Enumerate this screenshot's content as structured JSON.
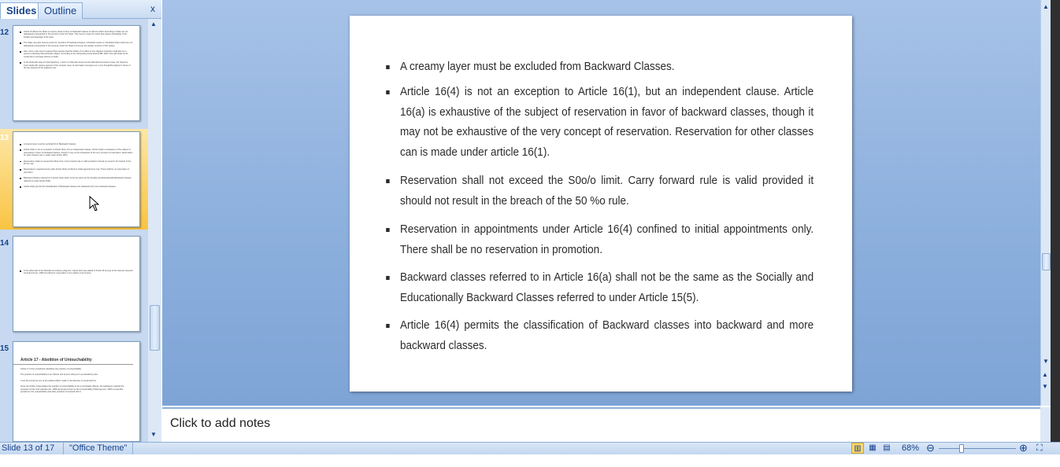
{
  "left_pane": {
    "tabs": [
      "Slides",
      "Outline"
    ],
    "close_glyph": "x",
    "slides": [
      {
        "number": "12",
        "bullets": [
          "Article 16 allows the State to reserve seats in favor of backward classes of citizens which according to State are not adequately represented in the services under the State. This may be meant for posts that require knowledge of the locality and language of the area.",
          "The State may also reserve posts for members of backward classes, scheduled castes or scheduled tribes which are not adequately represented in the services under the State to bring up the weaker sections of the society.",
          "Also, there a law may be passed that requires that the holder of an office of any religious institution shall also be a person professing that particular religion. According to the Citizenship (Amendment) Bill, 2003, this right shall not be conferred to overseas citizens of India.",
          "In the landmark case of Indra Sawhney v Union of India also known as the Mandal Commission Case, the Supreme Court dealt with various aspects of the complex issue of reservation and gave out a very thoughtful judgment. Some of the key aspects of the judgment are:"
        ]
      },
      {
        "number": "13",
        "bullets": [
          "A creamy layer must be excluded from Backward Classes.",
          "Article 16(4) is not an exception to Article 16(1), but an independent clause. Article 16(a) is exhaustive of the subject of reservation in favor of backward classes, though it may not be exhaustive of the very concept of reservation. Reservation for other classes can is made under article 16(1).",
          "Reservation shall not exceed the 50o/o limit. Carry forward rule is valid provided it should not result in the breach of the 50 %o rule.",
          "Reservation in appointments under Article 16(4) confined to initial appointments only. There shall be no reservation in promotion.",
          "Backward classes referred to in Article 16(a) shall not be the same as the Socially and Educationally Backward Classes referred to under Article 15(5).",
          "Article 16(4) permits the classification of Backward classes into backward and more backward classes."
        ]
      },
      {
        "number": "14",
        "bullets": [
          "In the aftermath of the Mandal commission judgment, clause (4A) was added in Article 16 by way of the Seventy Seventh Amendment Act, 1995 providing for reservation in the matters of promotion."
        ]
      },
      {
        "number": "15",
        "title": "Article 17 - Abolition of Untouchability",
        "paragraphs": [
          "Article 17 of the constitution abolishes the practice of untouchability.",
          "The practice of untouchability is an offense and anyone doing so is punishable by law.",
          "It can be termed as one of the earliest efforts made in the direction of social reforms.",
          "Since the Article contemplates the practice of untouchability to be a punishable offense, the legislature enacted the protection of the Civil Liberties Act, 1955 previously known as the Untouchability (Offenses) Act, 1955 to prescribe punishment for untouchability and other practices connected with it."
        ]
      }
    ]
  },
  "main_slide": {
    "bullets": [
      "A creamy layer must be excluded from Backward Classes.",
      "Article 16(4) is not an exception to Article 16(1), but an independent clause. Article 16(a) is exhaustive of the subject of reservation in favor of backward classes, though it may not be exhaustive of the very concept of reservation. Reservation for other classes can is made under article 16(1).",
      "Reservation shall not exceed the S0o/o limit. Carry forward rule is valid provided it should not result in the breach of the 50 %o rule.",
      " Reservation in appointments under Article 16(4) confined to initial appointments only. There shall be no reservation in promotion.",
      "Backward classes referred to in Article 16(a) shall not be the same as the Socially and Educationally Backward Classes referred to under Article 15(5).",
      "Article 16(4) permits the classification of Backward classes into backward and more backward classes."
    ]
  },
  "notes": {
    "placeholder": "Click to add notes"
  },
  "status_bar": {
    "slide_position": "Slide 13 of 17",
    "theme": "\"Office Theme\"",
    "zoom": "68%",
    "zoom_out_glyph": "⊖",
    "zoom_in_glyph": "⊕"
  },
  "colors": {
    "selected_thumbnail": "#f9c443",
    "editor_background": "#8db0dd",
    "pane_background": "#c6d9f1"
  },
  "icons": [
    "close-icon",
    "normal-view-icon",
    "slide-sorter-icon",
    "slide-show-icon",
    "zoom-out-icon",
    "zoom-in-icon",
    "fit-to-window-icon",
    "scroll-up-icon",
    "scroll-down-icon",
    "previous-slide-icon",
    "next-slide-icon"
  ]
}
